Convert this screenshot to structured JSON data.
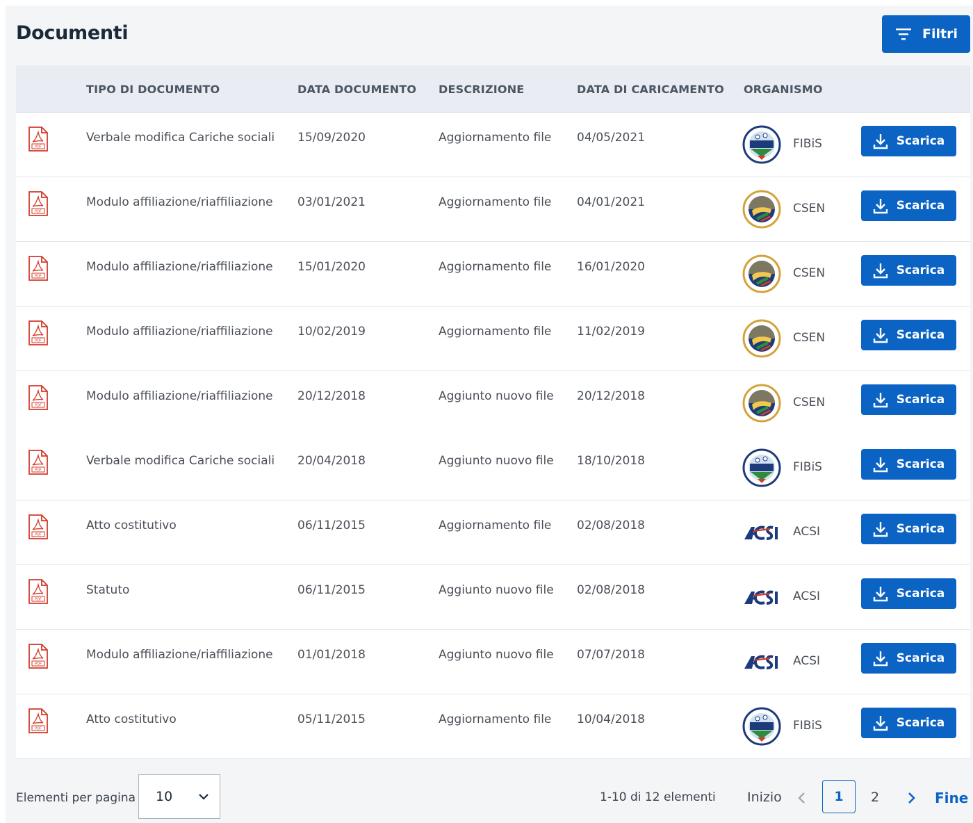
{
  "header": {
    "title": "Documenti",
    "filter_label": "Filtri"
  },
  "table": {
    "columns": [
      "TIPO DI DOCUMENTO",
      "DATA DOCUMENTO",
      "DESCRIZIONE",
      "DATA DI CARICAMENTO",
      "ORGANISMO"
    ],
    "download_label": "Scarica",
    "rows": [
      {
        "tipo": "Verbale modifica Cariche sociali",
        "data_doc": "15/09/2020",
        "descrizione": "Aggiornamento file",
        "data_car": "04/05/2021",
        "organismo": "FIBiS",
        "logo": "fibis"
      },
      {
        "tipo": "Modulo affiliazione/riaffiliazione",
        "data_doc": "03/01/2021",
        "descrizione": "Aggiornamento file",
        "data_car": "04/01/2021",
        "organismo": "CSEN",
        "logo": "csen"
      },
      {
        "tipo": "Modulo affiliazione/riaffiliazione",
        "data_doc": "15/01/2020",
        "descrizione": "Aggiornamento file",
        "data_car": "16/01/2020",
        "organismo": "CSEN",
        "logo": "csen"
      },
      {
        "tipo": "Modulo affiliazione/riaffiliazione",
        "data_doc": "10/02/2019",
        "descrizione": "Aggiornamento file",
        "data_car": "11/02/2019",
        "organismo": "CSEN",
        "logo": "csen"
      },
      {
        "tipo": "Modulo affiliazione/riaffiliazione",
        "data_doc": "20/12/2018",
        "descrizione": "Aggiunto nuovo file",
        "data_car": "20/12/2018",
        "organismo": "CSEN",
        "logo": "csen"
      },
      {
        "tipo": "Verbale modifica Cariche sociali",
        "data_doc": "20/04/2018",
        "descrizione": "Aggiunto nuovo file",
        "data_car": "18/10/2018",
        "organismo": "FIBiS",
        "logo": "fibis"
      },
      {
        "tipo": "Atto costitutivo",
        "data_doc": "06/11/2015",
        "descrizione": "Aggiornamento file",
        "data_car": "02/08/2018",
        "organismo": "ACSI",
        "logo": "acsi"
      },
      {
        "tipo": "Statuto",
        "data_doc": "06/11/2015",
        "descrizione": "Aggiunto nuovo file",
        "data_car": "02/08/2018",
        "organismo": "ACSI",
        "logo": "acsi"
      },
      {
        "tipo": "Modulo affiliazione/riaffiliazione",
        "data_doc": "01/01/2018",
        "descrizione": "Aggiunto nuovo file",
        "data_car": "07/07/2018",
        "organismo": "ACSI",
        "logo": "acsi"
      },
      {
        "tipo": "Atto costitutivo",
        "data_doc": "05/11/2015",
        "descrizione": "Aggiornamento file",
        "data_car": "10/04/2018",
        "organismo": "FIBiS",
        "logo": "fibis"
      }
    ]
  },
  "footer": {
    "per_page_label": "Elementi per pagina",
    "per_page_value": "10",
    "range_text": "1-10 di 12 elementi",
    "first_label": "Inizio",
    "current_page": "1",
    "next_page": "2",
    "last_label": "Fine"
  },
  "colors": {
    "primary": "#0b63c4",
    "header_bg": "#e9edf3",
    "pdf_red": "#d23a2b"
  },
  "icons": {
    "filter": "filter-icon",
    "download": "download-icon",
    "pdf": "pdf-file-icon",
    "prev": "chevron-left-icon",
    "next": "chevron-right-icon",
    "dropdown": "chevron-down-icon"
  }
}
